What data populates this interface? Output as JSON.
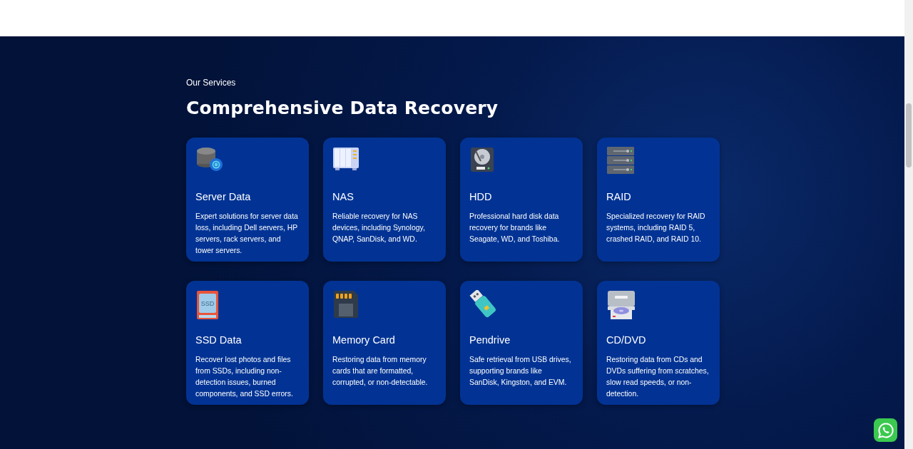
{
  "section": {
    "eyebrow": "Our Services",
    "title": "Comprehensive Data Recovery"
  },
  "services": [
    {
      "kind": "server",
      "title": "Server Data",
      "description": "Expert solutions for server data loss, including Dell servers, HP servers, rack servers, and tower servers."
    },
    {
      "kind": "nas",
      "title": "NAS",
      "description": "Reliable recovery for NAS devices, including Synology, QNAP, SanDisk, and WD."
    },
    {
      "kind": "hdd",
      "title": "HDD",
      "description": "Professional hard disk data recovery for brands like Seagate, WD, and Toshiba."
    },
    {
      "kind": "raid",
      "title": "RAID",
      "description": "Specialized recovery for RAID systems, including RAID 5, crashed RAID, and RAID 10."
    },
    {
      "kind": "ssd",
      "icon_text": "SSD",
      "title": "SSD Data",
      "description": "Recover lost photos and files from SSDs, including non-detection issues, burned components, and SSD errors."
    },
    {
      "kind": "memory",
      "title": "Memory Card",
      "description": "Restoring data from memory cards that are formatted, corrupted, or non-detectable."
    },
    {
      "kind": "usb",
      "title": "Pendrive",
      "description": "Safe retrieval from USB drives, supporting brands like SanDisk, Kingston, and EVM."
    },
    {
      "kind": "disc",
      "title": "CD/DVD",
      "description": "Restoring data from CDs and DVDs suffering from scratches, slow read speeds, or non-detection."
    }
  ]
}
